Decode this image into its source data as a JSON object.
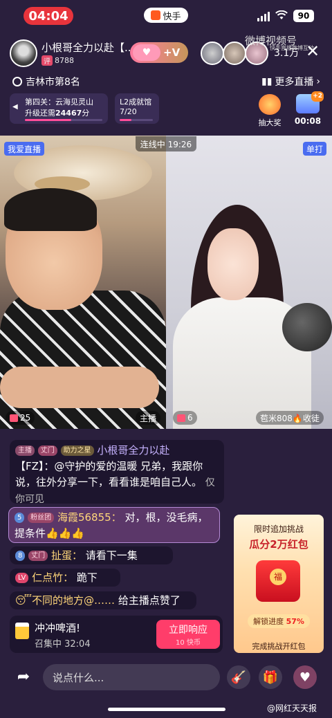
{
  "status_bar": {
    "time": "04:04",
    "app_name": "快手",
    "battery": "90"
  },
  "streamer": {
    "name": "小根哥全力以赴【...",
    "level_tag": "评",
    "score": "8788",
    "follow_label": "+V"
  },
  "watermark": {
    "top": "微博视频号",
    "top_sub": "快手直播微博互动",
    "bottom": "@网红天天报"
  },
  "viewers": {
    "count": "3.1万"
  },
  "rank": {
    "label": "吉林市第8名",
    "more_live": "更多直播"
  },
  "progress_cards": [
    {
      "title": "第四关：云海见灵山",
      "sub_prefix": "升级还需",
      "sub_value": "24467",
      "sub_suffix": "分",
      "progress": 0.6
    },
    {
      "title": "L2成就馆",
      "sub": "7/20",
      "progress": 0.35
    }
  ],
  "activities": {
    "lottery": "抽大奖",
    "timer": "00:08",
    "timer_badge": "+2"
  },
  "video": {
    "left_tag": "我爱直播",
    "right_tag": "单打",
    "connect": "连线中 19:26",
    "left_gifts": "25",
    "host_label": "主播",
    "right_gifts": "6",
    "income": "苞米808🔥收徒"
  },
  "chat": [
    {
      "badges": [
        "主播",
        "丈门",
        "助力之星"
      ],
      "user": "小根哥全力以赴",
      "text": "【FZ】：@守护的爱的温暖 兄弟，我跟你说，往外分享一下，看看谁是咱自己人。",
      "note": "仅你可见"
    },
    {
      "badges": [
        "5",
        "粉丝团"
      ],
      "user": "海霞56855：",
      "text": "对，根，没毛病，提条件👍👍👍"
    },
    {
      "badges": [
        "8",
        "丈门"
      ],
      "user": "扯蛋：",
      "text": "请看下一集"
    },
    {
      "badges": [
        "LV"
      ],
      "user": "仁点竹：",
      "text": "跪下"
    },
    {
      "user": "😴不同的地方@……",
      "text": "给主播点赞了"
    }
  ],
  "challenge": {
    "title": "冲冲啤酒!",
    "sub": "召集中 32:04",
    "button": "立即响应",
    "button_sub": "10 快币"
  },
  "red_packet": {
    "title": "限时追加挑战",
    "prize": "瓜分2万红包",
    "progress_label": "解锁进度",
    "progress_value": "57%",
    "footer": "完成挑战开红包",
    "coin": "福"
  },
  "bottom_bar": {
    "placeholder": "说点什么..."
  }
}
